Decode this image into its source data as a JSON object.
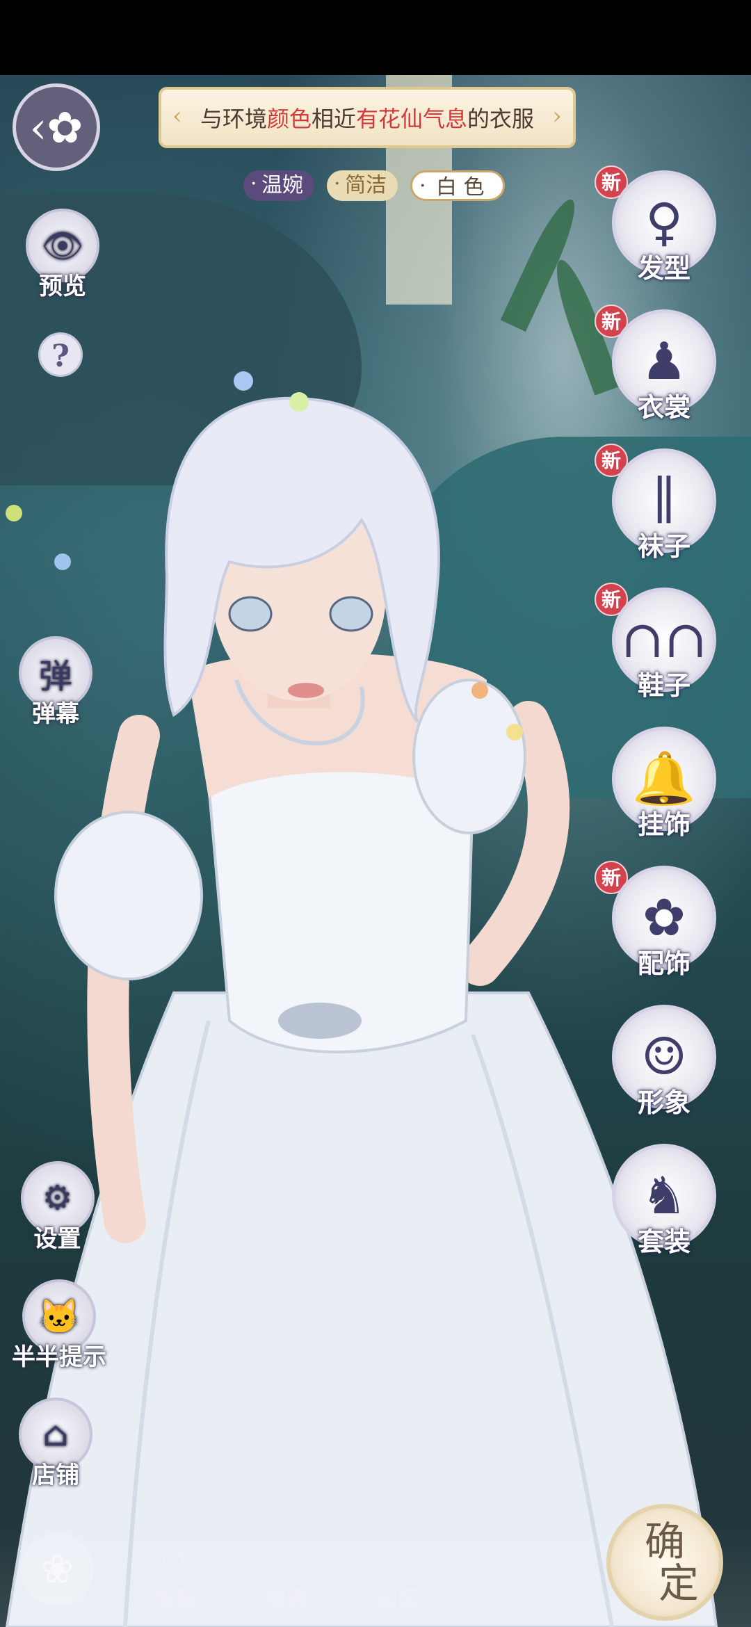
{
  "hint": {
    "prefix": "与环境",
    "color_word": "颜色",
    "middle": "相近",
    "fairy_word": "有花仙气息",
    "suffix": "的衣服"
  },
  "tags": [
    "温婉",
    "简洁",
    "白 色"
  ],
  "left_tools": {
    "preview": "预览",
    "help": "?",
    "danmaku_icon": "弹",
    "danmaku": "弹幕",
    "settings": "设置",
    "hint": "半半提示",
    "store": "店铺"
  },
  "categories": [
    {
      "label": "发型",
      "new": true,
      "icon": "hair-icon"
    },
    {
      "label": "衣裳",
      "new": true,
      "icon": "dress-icon"
    },
    {
      "label": "袜子",
      "new": true,
      "icon": "socks-icon"
    },
    {
      "label": "鞋子",
      "new": true,
      "icon": "shoes-icon"
    },
    {
      "label": "挂饰",
      "new": false,
      "icon": "pendant-icon"
    },
    {
      "label": "配饰",
      "new": true,
      "icon": "accessory-icon"
    },
    {
      "label": "形象",
      "new": false,
      "icon": "appearance-icon"
    },
    {
      "label": "套装",
      "new": false,
      "icon": "suit-icon"
    }
  ],
  "new_badge": "新",
  "bottom": {
    "restore": "恢复",
    "search": "搜索",
    "memory": "回忆",
    "confirm_line1": "确",
    "confirm_line2": "定"
  },
  "colors": {
    "accent_red": "#d23a3a",
    "tag_purple": "#5b4a7c",
    "badge_red": "#d2434d"
  }
}
